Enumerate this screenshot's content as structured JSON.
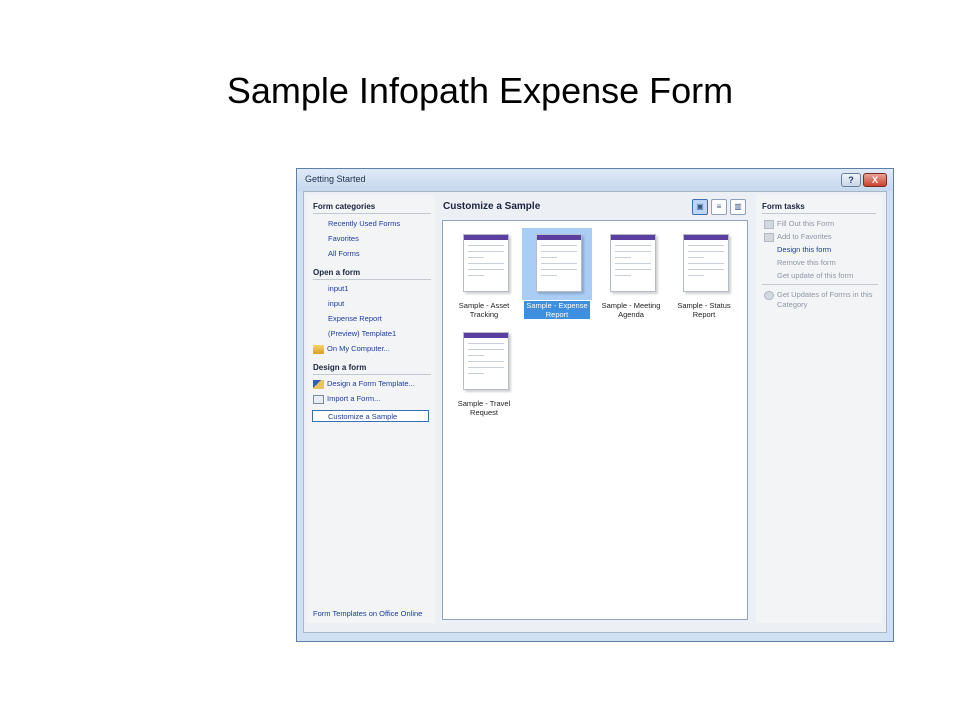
{
  "slide": {
    "title": "Sample Infopath Expense Form"
  },
  "window": {
    "title": "Getting Started",
    "help_glyph": "?",
    "close_glyph": "X"
  },
  "left": {
    "categories_heading": "Form categories",
    "categories": [
      "Recently Used Forms",
      "Favorites",
      "All Forms"
    ],
    "open_heading": "Open a form",
    "open_items": [
      "input1",
      "input",
      "Expense Report",
      "(Preview) Template1"
    ],
    "on_my_computer": "On My Computer...",
    "design_heading": "Design a form",
    "design_template": "Design a Form Template...",
    "import_form": "Import a Form...",
    "customize_sample": "Customize a Sample",
    "bottom_link": "Form Templates on Office Online"
  },
  "middle": {
    "heading": "Customize a Sample",
    "view_icons": [
      "large-icons-view-icon",
      "list-view-icon",
      "details-view-icon"
    ],
    "samples": [
      {
        "line1": "Sample - Asset",
        "line2": "Tracking",
        "selected": false
      },
      {
        "line1": "Sample - Expense",
        "line2": "Report",
        "selected": true
      },
      {
        "line1": "Sample - Meeting",
        "line2": "Agenda",
        "selected": false
      },
      {
        "line1": "Sample - Status",
        "line2": "Report",
        "selected": false
      },
      {
        "line1": "Sample - Travel",
        "line2": "Request",
        "selected": false
      }
    ]
  },
  "right": {
    "heading": "Form tasks",
    "tasks": [
      "Fill Out this Form",
      "Add to Favorites",
      "Design this form",
      "Remove this form",
      "Get update of this form"
    ],
    "updates_line1": "Get Updates of Forms in this",
    "updates_line2": "Category"
  },
  "colors": {
    "accent": "#3d8fe0",
    "link": "#1b3d9c",
    "thumb_band": "#5b3fa0"
  }
}
